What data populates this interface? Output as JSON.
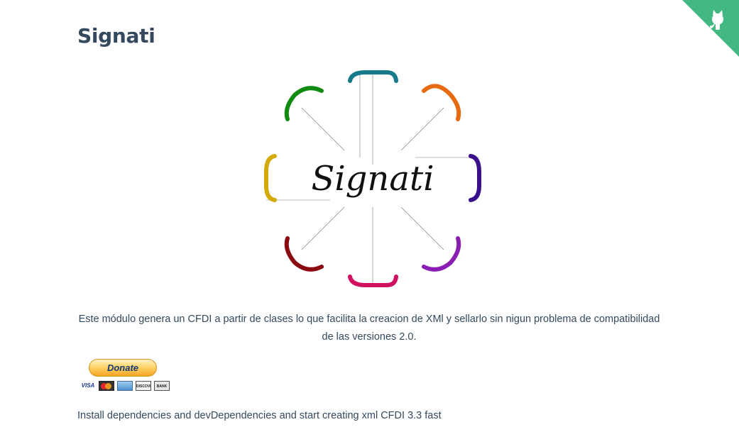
{
  "page": {
    "title": "Signati",
    "logo_text": "Signati",
    "description": "Este módulo genera un CFDI a partir de clases lo que facilita la creacion de XMl y sellarlo sin nigun problema de compatibilidad de las versiones 2.0.",
    "donate_label": "Donate",
    "payment_cards": [
      "VISA",
      "MasterCard",
      "AMEX",
      "DISCOVER",
      "BANK"
    ],
    "install_text": "Install dependencies and devDependencies and start creating xml CFDI 3.3 fast"
  },
  "colors": {
    "accent": "#42b983",
    "heading": "#34495e",
    "logo_petals": [
      "#167a8b",
      "#e86a10",
      "#3a0f8c",
      "#8b1eb2",
      "#d01060",
      "#8b0a12",
      "#d4a90a",
      "#118a12"
    ]
  },
  "icons": {
    "corner": "github-octocat-icon"
  }
}
